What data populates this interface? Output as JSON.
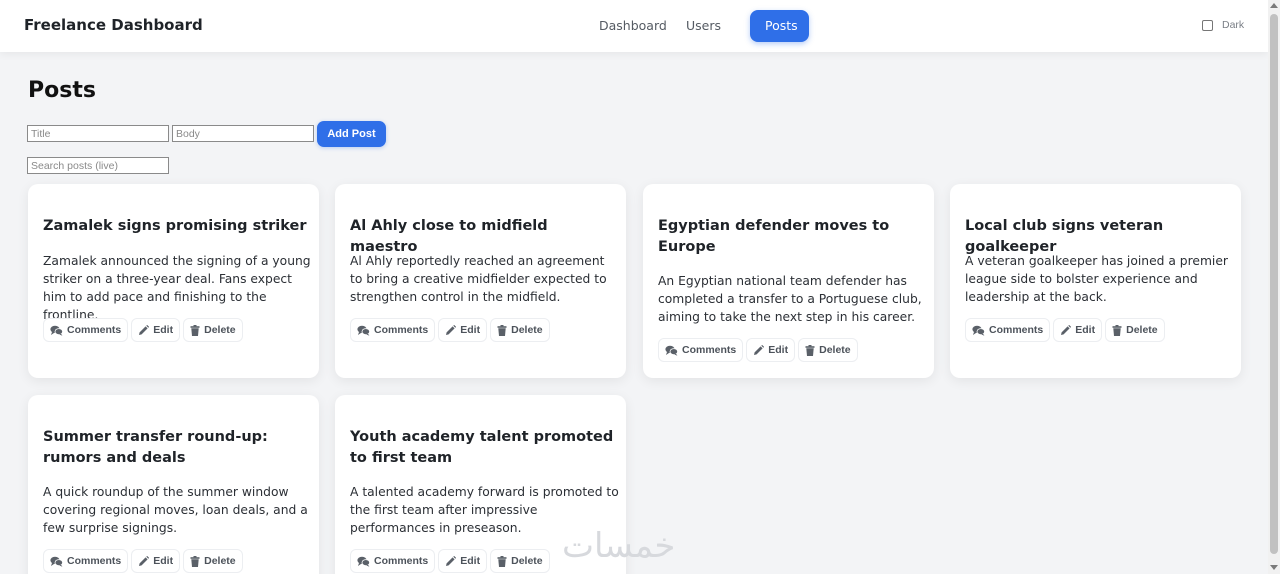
{
  "header": {
    "brand": "Freelance Dashboard",
    "nav": [
      {
        "label": "Dashboard",
        "active": false
      },
      {
        "label": "Users",
        "active": false
      },
      {
        "label": "Posts",
        "active": true
      }
    ],
    "theme_toggle_label": "Dark",
    "theme_dark": false
  },
  "page": {
    "title": "Posts",
    "title_placeholder": "Title",
    "body_placeholder": "Body",
    "add_button": "Add Post",
    "search_placeholder": "Search posts (live)"
  },
  "actions": {
    "comments": "Comments",
    "edit": "Edit",
    "delete": "Delete"
  },
  "posts": [
    {
      "title": "Zamalek signs promising striker",
      "body": "Zamalek announced the signing of a young striker on a three-year deal. Fans expect him to add pace and finishing to the frontline."
    },
    {
      "title": "Al Ahly close to midfield maestro",
      "body": "Al Ahly reportedly reached an agreement to bring a creative midfielder expected to strengthen control in the midfield."
    },
    {
      "title": "Egyptian defender moves to Europe",
      "body": "An Egyptian national team defender has completed a transfer to a Portuguese club, aiming to take the next step in his career."
    },
    {
      "title": "Local club signs veteran goalkeeper",
      "body": "A veteran goalkeeper has joined a premier league side to bolster experience and leadership at the back."
    },
    {
      "title": "Summer transfer round-up: rumors and deals",
      "body": "A quick roundup of the summer window covering regional moves, loan deals, and a few surprise signings."
    },
    {
      "title": "Youth academy talent promoted to first team",
      "body": "A talented academy forward is promoted to the first team after impressive performances in preseason."
    }
  ],
  "colors": {
    "accent": "#2f6fe8",
    "background": "#f3f4f6"
  },
  "watermark": "خمسات"
}
